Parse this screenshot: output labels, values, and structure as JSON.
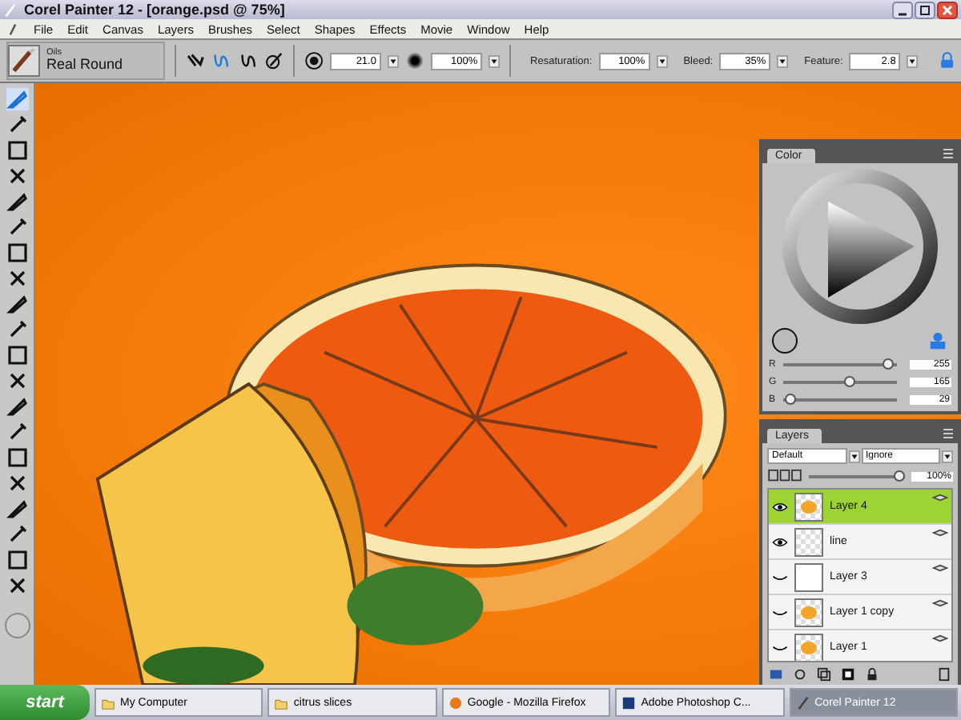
{
  "window": {
    "title": "Corel Painter 12 - [orange.psd @ 75%]"
  },
  "menu": [
    "File",
    "Edit",
    "Canvas",
    "Layers",
    "Brushes",
    "Select",
    "Shapes",
    "Effects",
    "Movie",
    "Window",
    "Help"
  ],
  "property_bar": {
    "category": "Oils",
    "variant": "Real Round",
    "size": "21.0",
    "opacity": "100%",
    "fields": [
      {
        "label": "Resaturation:",
        "value": "100%"
      },
      {
        "label": "Bleed:",
        "value": "35%"
      },
      {
        "label": "Feature:",
        "value": "2.8"
      }
    ]
  },
  "toolbox": [
    {
      "selected": true
    },
    {
      "selected": false
    },
    {
      "selected": false
    },
    {
      "selected": false
    },
    {
      "selected": false
    },
    {
      "selected": false
    },
    {
      "selected": false
    },
    {
      "selected": false
    },
    {
      "selected": false
    },
    {
      "selected": false
    },
    {
      "selected": false
    },
    {
      "selected": false
    },
    {
      "selected": false
    },
    {
      "selected": false
    },
    {
      "selected": false
    },
    {
      "selected": false
    },
    {
      "selected": false
    },
    {
      "selected": false
    },
    {
      "selected": false
    },
    {
      "selected": false
    }
  ],
  "color_panel": {
    "title": "Color",
    "channels": [
      {
        "name": "R",
        "level": 0.97,
        "value": "255"
      },
      {
        "name": "G",
        "level": 0.64,
        "value": "165"
      },
      {
        "name": "B",
        "level": 0.11,
        "value": "29"
      }
    ]
  },
  "layers_panel": {
    "title": "Layers",
    "composite": "Default",
    "depth": "Ignore",
    "opacity": "100%",
    "opacity_slider": {
      "level": 1
    },
    "layers": [
      {
        "name": "Layer 4",
        "visible": true,
        "selected": true,
        "kind": "painted"
      },
      {
        "name": "line",
        "visible": true,
        "selected": false,
        "kind": "transparent"
      },
      {
        "name": "Layer 3",
        "visible": false,
        "selected": false,
        "kind": "white"
      },
      {
        "name": "Layer 1 copy",
        "visible": false,
        "selected": false,
        "kind": "painted"
      },
      {
        "name": "Layer 1",
        "visible": false,
        "selected": false,
        "kind": "painted"
      }
    ]
  },
  "taskbar": {
    "start": "start",
    "items": [
      {
        "label": "My Computer",
        "kind": "folder",
        "selected": false
      },
      {
        "label": "citrus slices",
        "kind": "folder",
        "selected": false
      },
      {
        "label": "Google - Mozilla Firefox",
        "kind": "browser",
        "selected": false
      },
      {
        "label": "Adobe Photoshop C...",
        "kind": "app",
        "selected": false
      },
      {
        "label": "Corel Painter 12",
        "kind": "painter",
        "selected": true
      }
    ]
  }
}
